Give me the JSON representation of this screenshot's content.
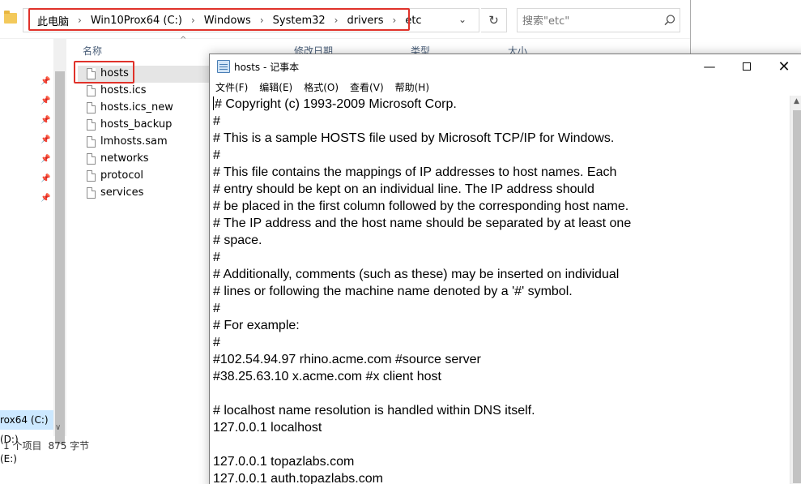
{
  "explorer": {
    "breadcrumbs": [
      "此电脑",
      "Win10Prox64 (C:)",
      "Windows",
      "System32",
      "drivers",
      "etc"
    ],
    "breadcrumb_separator": "›",
    "search_placeholder": "搜索\"etc\"",
    "columns": [
      "名称",
      "修改日期",
      "类型",
      "大小"
    ],
    "files": [
      {
        "name": "hosts",
        "selected": true
      },
      {
        "name": "hosts.ics",
        "selected": false
      },
      {
        "name": "hosts.ics_new",
        "selected": false
      },
      {
        "name": "hosts_backup",
        "selected": false
      },
      {
        "name": "lmhosts.sam",
        "selected": false
      },
      {
        "name": "networks",
        "selected": false
      },
      {
        "name": "protocol",
        "selected": false
      },
      {
        "name": "services",
        "selected": false
      }
    ],
    "nav_items": [
      {
        "label": "rox64 (C:)",
        "selected": true
      },
      {
        "label": "(D:)",
        "selected": false
      },
      {
        "label": "(E:)",
        "selected": false
      }
    ],
    "status": {
      "items_count": "1 个项目",
      "selection_size": "875 字节"
    },
    "highlight_color": "#e0322a"
  },
  "notepad": {
    "title": "hosts - 记事本",
    "menu": [
      "文件(F)",
      "编辑(E)",
      "格式(O)",
      "查看(V)",
      "帮助(H)"
    ],
    "lines": [
      "# Copyright (c) 1993-2009 Microsoft Corp.",
      "#",
      "# This is a sample HOSTS file used by Microsoft TCP/IP for Windows.",
      "#",
      "# This file contains the mappings of IP addresses to host names. Each",
      "# entry should be kept on an individual line. The IP address should",
      "# be placed in the first column followed by the corresponding host name.",
      "# The IP address and the host name should be separated by at least one",
      "# space.",
      "#",
      "# Additionally, comments (such as these) may be inserted on individual",
      "# lines or following the machine name denoted by a '#' symbol.",
      "#",
      "# For example:",
      "#",
      "#102.54.94.97 rhino.acme.com #source server",
      "#38.25.63.10 x.acme.com #x client host",
      "",
      "# localhost name resolution is handled within DNS itself.",
      "127.0.0.1 localhost",
      "",
      "127.0.0.1 topazlabs.com",
      "127.0.0.1 auth.topazlabs.com"
    ]
  }
}
